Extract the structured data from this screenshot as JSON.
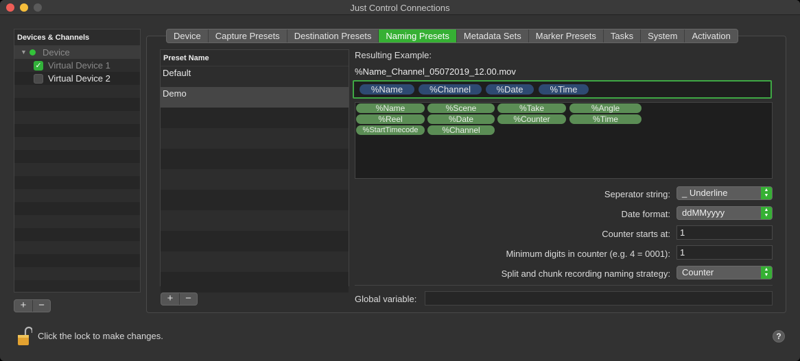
{
  "window": {
    "title": "Just Control Connections"
  },
  "devices": {
    "header": "Devices & Channels",
    "group": {
      "label": "Device",
      "status_color": "#33c23a"
    },
    "items": [
      {
        "label": "Virtual Device 1",
        "checked": true
      },
      {
        "label": "Virtual Device 2",
        "checked": false
      }
    ],
    "add_label": "+",
    "remove_label": "−"
  },
  "tabs": [
    {
      "label": "Device",
      "active": false
    },
    {
      "label": "Capture Presets",
      "active": false
    },
    {
      "label": "Destination Presets",
      "active": false
    },
    {
      "label": "Naming Presets",
      "active": true
    },
    {
      "label": "Metadata Sets",
      "active": false
    },
    {
      "label": "Marker Presets",
      "active": false
    },
    {
      "label": "Tasks",
      "active": false
    },
    {
      "label": "System",
      "active": false
    },
    {
      "label": "Activation",
      "active": false
    }
  ],
  "presets": {
    "header": "Preset Name",
    "items": [
      "Default",
      "Demo"
    ],
    "selected": "Demo",
    "add_label": "+",
    "remove_label": "−"
  },
  "naming": {
    "resulting_label": "Resulting Example:",
    "resulting_value": "%Name_Channel_05072019_12.00.mov",
    "selected_tokens": [
      "%Name",
      "%Channel",
      "%Date",
      "%Time"
    ],
    "available_tokens": [
      "%Name",
      "%Scene",
      "%Take",
      "%Angle",
      "%Reel",
      "%Date",
      "%Counter",
      "%Time",
      "%StartTimecode",
      "%Channel"
    ],
    "separator_label": "Seperator string:",
    "separator_value": "_ Underline",
    "date_format_label": "Date format:",
    "date_format_value": "ddMMyyyy",
    "counter_start_label": "Counter starts at:",
    "counter_start_value": "1",
    "min_digits_label": "Minimum digits in counter (e.g. 4 = 0001):",
    "min_digits_value": "1",
    "split_label": "Split and chunk recording naming strategy:",
    "split_value": "Counter",
    "global_label": "Global variable:",
    "global_value": ""
  },
  "footer": {
    "lock_text": "Click the lock to make changes.",
    "help_label": "?"
  },
  "colors": {
    "accent": "#36b034",
    "token_blue": "#2e4a72",
    "token_green": "#5b8d55"
  }
}
